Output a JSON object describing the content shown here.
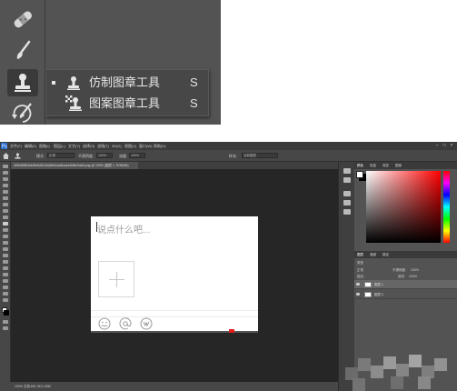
{
  "flyout": {
    "items": [
      {
        "label": "仿制图章工具",
        "shortcut": "S",
        "selected": true,
        "icon": "clone-stamp-icon"
      },
      {
        "label": "图案图章工具",
        "shortcut": "S",
        "selected": false,
        "icon": "pattern-stamp-icon"
      }
    ]
  },
  "photoshop": {
    "menu": [
      "文件(F)",
      "编辑(E)",
      "图像(I)",
      "图层(L)",
      "文字(Y)",
      "选择(S)",
      "滤镜(T)",
      "3D(D)",
      "视图(V)",
      "窗口(W)",
      "帮助(H)"
    ],
    "options": {
      "mode_label": "模式:",
      "mode_value": "正常",
      "opacity_label": "不透明度:",
      "opacity_value": "100%",
      "flow_label": "流量:",
      "flow_value": "100%",
      "sample_label": "样本:",
      "sample_value": "当前图层"
    },
    "document_tab": "d9f0c8f5b4eb9fe6d51d0db5e1aa3baad4bf8e0da9.png @ 100% (图层 1, RGB/8#)",
    "status": "100%     文档:691.2K/1.09M",
    "document": {
      "placeholder": "说点什么吧..."
    },
    "panel_tabs": [
      "颜色",
      "色板",
      "渐变",
      "图案"
    ],
    "layer_panel_tabs": [
      "图层",
      "通道",
      "路径"
    ],
    "layers": [
      {
        "name": "图层 1"
      },
      {
        "name": "图层 0"
      }
    ],
    "layer_controls": {
      "kind_label": "类型",
      "mode_value": "正常",
      "opacity_label": "不透明度:",
      "opacity_value": "100%",
      "fill_label": "填充:",
      "fill_value": "100%",
      "lock_label": "锁定:"
    }
  },
  "colors": {
    "ps_dark": "#535353",
    "menubar": "#3b3b3b",
    "canvas_bg": "#262626",
    "accent_red": "#e02020"
  }
}
